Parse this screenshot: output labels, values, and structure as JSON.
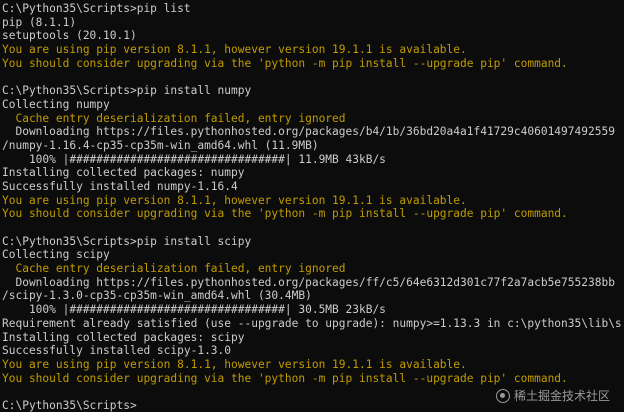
{
  "terminal": {
    "lines": [
      {
        "text": "C:\\Python35\\Scripts>pip list",
        "style": "normal"
      },
      {
        "text": "pip (8.1.1)",
        "style": "normal"
      },
      {
        "text": "setuptools (20.10.1)",
        "style": "normal"
      },
      {
        "text": "You are using pip version 8.1.1, however version 19.1.1 is available.",
        "style": "warn"
      },
      {
        "text": "You should consider upgrading via the 'python -m pip install --upgrade pip' command.",
        "style": "warn"
      },
      {
        "text": "",
        "style": "blank"
      },
      {
        "text": "C:\\Python35\\Scripts>pip install numpy",
        "style": "normal"
      },
      {
        "text": "Collecting numpy",
        "style": "normal"
      },
      {
        "text": "  Cache entry deserialization failed, entry ignored",
        "style": "warn"
      },
      {
        "text": "  Downloading https://files.pythonhosted.org/packages/b4/1b/36bd20a4a1f41729c40601497492559",
        "style": "normal"
      },
      {
        "text": "/numpy-1.16.4-cp35-cp35m-win_amd64.whl (11.9MB)",
        "style": "normal"
      },
      {
        "text": "    100% |################################| 11.9MB 43kB/s",
        "style": "normal"
      },
      {
        "text": "Installing collected packages: numpy",
        "style": "normal"
      },
      {
        "text": "Successfully installed numpy-1.16.4",
        "style": "normal"
      },
      {
        "text": "You are using pip version 8.1.1, however version 19.1.1 is available.",
        "style": "warn"
      },
      {
        "text": "You should consider upgrading via the 'python -m pip install --upgrade pip' command.",
        "style": "warn"
      },
      {
        "text": "",
        "style": "blank"
      },
      {
        "text": "C:\\Python35\\Scripts>pip install scipy",
        "style": "normal"
      },
      {
        "text": "Collecting scipy",
        "style": "normal"
      },
      {
        "text": "  Cache entry deserialization failed, entry ignored",
        "style": "warn"
      },
      {
        "text": "  Downloading https://files.pythonhosted.org/packages/ff/c5/64e6312d301c77f2a7acb5e755238bb",
        "style": "normal"
      },
      {
        "text": "/scipy-1.3.0-cp35-cp35m-win_amd64.whl (30.4MB)",
        "style": "normal"
      },
      {
        "text": "    100% |################################| 30.5MB 23kB/s",
        "style": "normal"
      },
      {
        "text": "Requirement already satisfied (use --upgrade to upgrade): numpy>=1.13.3 in c:\\python35\\lib\\s",
        "style": "normal"
      },
      {
        "text": "Installing collected packages: scipy",
        "style": "normal"
      },
      {
        "text": "Successfully installed scipy-1.3.0",
        "style": "normal"
      },
      {
        "text": "You are using pip version 8.1.1, however version 19.1.1 is available.",
        "style": "warn"
      },
      {
        "text": "You should consider upgrading via the 'python -m pip install --upgrade pip' command.",
        "style": "warn"
      },
      {
        "text": "",
        "style": "blank"
      },
      {
        "text": "C:\\Python35\\Scripts>",
        "style": "prompt"
      }
    ],
    "colors": {
      "background": "#0c0c0c",
      "text": "#cccccc",
      "warning": "#c19c00"
    }
  },
  "watermark": {
    "text": "稀土掘金技术社区",
    "icon": "juejin-logo-icon"
  }
}
